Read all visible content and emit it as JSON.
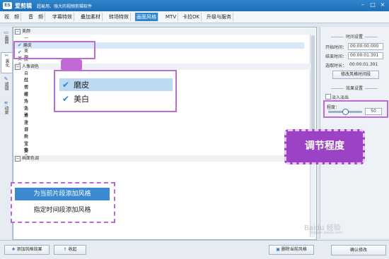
{
  "app": {
    "logo_text": "ES",
    "title": "爱剪辑",
    "slogan": "超易用、强大的视频剪辑软件"
  },
  "window_controls": [
    "–",
    "□",
    "×"
  ],
  "menu": {
    "items": [
      "视　频",
      "音　频",
      "字幕特效",
      "叠加素材",
      "转场特效",
      "画面风格",
      "MTV",
      "卡拉OK",
      "升级与服务"
    ],
    "active": "画面风格"
  },
  "side_tabs": [
    {
      "label": "画面",
      "icon": "▭"
    },
    {
      "label": "美化",
      "icon": "✂"
    },
    {
      "label": "滤镜",
      "icon": "✎"
    },
    {
      "label": "动景",
      "icon": "≋"
    }
  ],
  "list": {
    "rows": [
      {
        "type": "category",
        "toggle": "−",
        "label": "美颜"
      },
      {
        "type": "item",
        "label": "一键美颜",
        "checked": false
      },
      {
        "type": "item",
        "label": "磨皮",
        "checked": true,
        "selected": true
      },
      {
        "type": "item",
        "label": "美白",
        "checked": true
      },
      {
        "type": "item",
        "label": "肤色",
        "checked": false
      },
      {
        "type": "category",
        "toggle": "−",
        "label": "人像调色"
      },
      {
        "type": "item",
        "label": "自然",
        "checked": false
      },
      {
        "type": "item",
        "label": "红润",
        "checked": false
      },
      {
        "type": "item",
        "label": "青嫩",
        "checked": false
      },
      {
        "type": "item",
        "label": "暖色",
        "checked": false
      },
      {
        "type": "item",
        "label": "冷色",
        "checked": false
      },
      {
        "type": "item",
        "label": "淡雅",
        "checked": false
      },
      {
        "type": "item",
        "label": "素净",
        "checked": false
      },
      {
        "type": "item",
        "label": "蓝调",
        "checked": false
      },
      {
        "type": "item",
        "label": "日系",
        "checked": false
      },
      {
        "type": "item",
        "label": "阿宝色",
        "checked": false
      },
      {
        "type": "item",
        "label": "宝丽来",
        "checked": false
      },
      {
        "type": "item",
        "label": "复古",
        "checked": false
      },
      {
        "type": "category",
        "toggle": "−",
        "label": "画面色调"
      }
    ]
  },
  "right_panel": {
    "time_header": "时间设置",
    "start_label": "开始时间：",
    "start_value": "00:00:00.000",
    "end_label": "结束时间：",
    "end_value": "00:00:01.301",
    "duration_label": "选取时长：",
    "duration_value": "00:00:01.301",
    "modify_button": "修改风格时间段",
    "effect_header": "效果设置",
    "fade_label": "淡入淡出",
    "degree_label": "程度：",
    "degree_value": "50",
    "degree_fraction": 0.5
  },
  "bottom": {
    "add_button": "添加风格效果",
    "collapse_button": "收起",
    "delete_button": "删除当前风格",
    "confirm_button": "确认修改"
  },
  "callout_list": {
    "items": [
      "磨皮",
      "美白"
    ]
  },
  "callout_menu": {
    "items": [
      "为当前片段添加风格",
      "指定时间段添加风格"
    ]
  },
  "badge": {
    "text": "调节程度"
  },
  "watermark": {
    "text": "Baidu 经验",
    "sub": "jingyan.baidu.com"
  },
  "colors": {
    "accent": "#2f86cc",
    "highlight": "#c06ad6",
    "badge": "#9b43c4"
  }
}
